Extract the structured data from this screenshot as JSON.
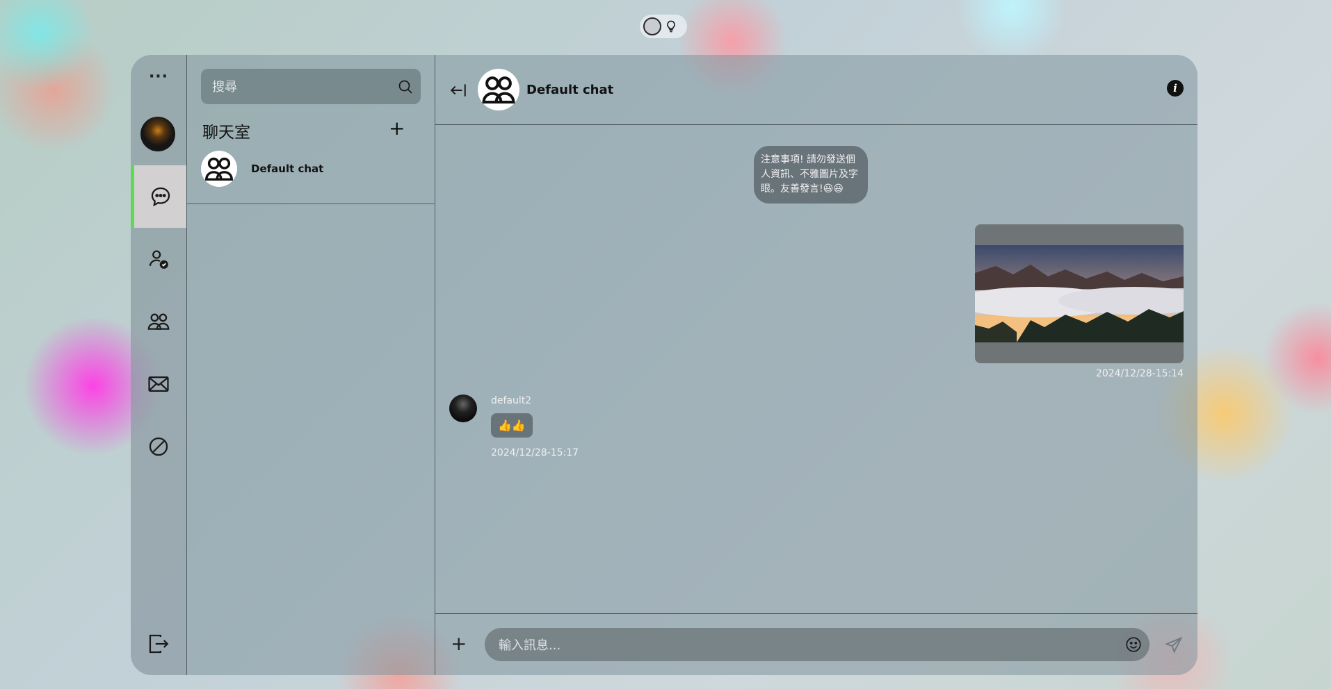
{
  "sidebar": {
    "more_label": "···",
    "items": [
      {
        "icon": "chat-bubble-icon",
        "active": true
      },
      {
        "icon": "user-check-icon",
        "active": false
      },
      {
        "icon": "users-icon",
        "active": false
      },
      {
        "icon": "mail-icon",
        "active": false
      },
      {
        "icon": "block-icon",
        "active": false
      }
    ],
    "accent": "#5adc4e"
  },
  "search": {
    "placeholder": "搜尋"
  },
  "rooms": {
    "title": "聊天室",
    "add_label": "+",
    "items": [
      {
        "name": "Default chat"
      }
    ]
  },
  "chat": {
    "title": "Default chat",
    "info_label": "i",
    "notice": "注意事項! 請勿發送個人資訊、不雅圖片及字眼。友善發言!😃😃",
    "messages": [
      {
        "direction": "outgoing",
        "type": "image",
        "timestamp": "2024/12/28-15:14"
      },
      {
        "direction": "incoming",
        "type": "text",
        "sender": "default2",
        "text": "👍👍",
        "timestamp": "2024/12/28-15:17"
      }
    ]
  },
  "composer": {
    "add_label": "+",
    "placeholder": "輸入訊息..."
  }
}
